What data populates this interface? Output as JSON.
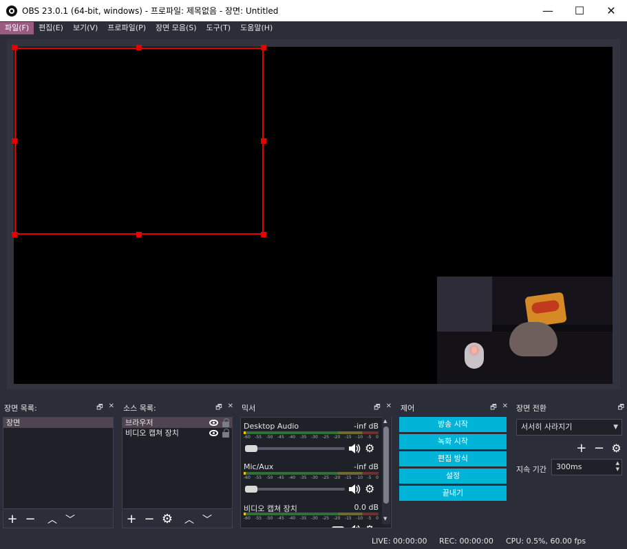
{
  "window": {
    "title": "OBS 23.0.1 (64-bit, windows) - 프로파일: 제목없음 - 장면: Untitled",
    "minimize": "—",
    "maximize": "☐",
    "close": "✕"
  },
  "menu": [
    {
      "label": "파일(F)"
    },
    {
      "label": "편집(E)"
    },
    {
      "label": "보기(V)"
    },
    {
      "label": "프로파일(P)"
    },
    {
      "label": "장면 모음(S)"
    },
    {
      "label": "도구(T)"
    },
    {
      "label": "도움말(H)"
    }
  ],
  "docks": {
    "scenes": {
      "title": "장면 목록:",
      "items": [
        "장면"
      ]
    },
    "sources": {
      "title": "소스 목록:",
      "items": [
        "브라우저",
        "비디오 캡쳐 장치"
      ]
    },
    "mixer": {
      "title": "믹서",
      "ticks": [
        "-60",
        "-55",
        "-50",
        "-45",
        "-40",
        "-35",
        "-30",
        "-25",
        "-20",
        "-15",
        "-10",
        "-5",
        "0"
      ],
      "channels": [
        {
          "name": "Desktop Audio",
          "level": "-inf dB"
        },
        {
          "name": "Mic/Aux",
          "level": "-inf dB"
        },
        {
          "name": "비디오 캡쳐 장치",
          "level": "0.0 dB"
        }
      ]
    },
    "controls": {
      "title": "제어",
      "buttons": [
        "방송 시작",
        "녹화 시작",
        "편집 방식",
        "설정",
        "끝내기"
      ]
    },
    "transitions": {
      "title": "장면 전환",
      "selected": "서서히 사라지기",
      "duration_label": "지속 기간",
      "duration_value": "300ms"
    }
  },
  "status": {
    "live": "LIVE: 00:00:00",
    "rec": "REC: 00:00:00",
    "cpu": "CPU: 0.5%, 60.00 fps"
  },
  "colors": {
    "background": "#2b2e38",
    "accent": "#00b4d8",
    "selection": "#e60000",
    "menu_active": "#9b5a80"
  }
}
